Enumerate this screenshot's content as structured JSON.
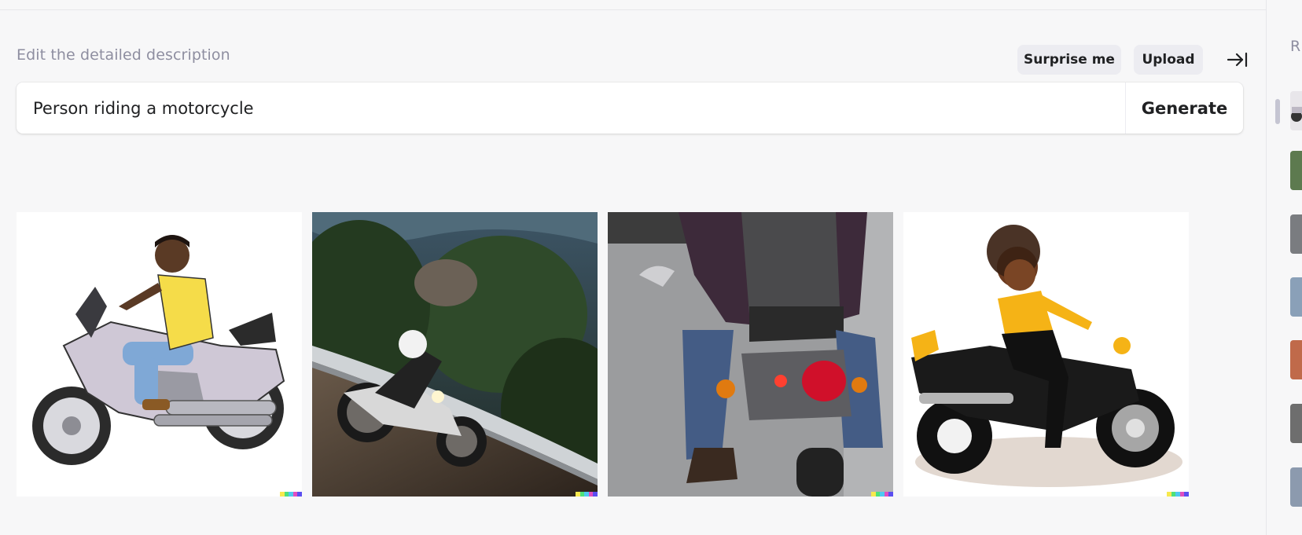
{
  "header": {
    "hint": "Edit the detailed description",
    "surprise_label": "Surprise me",
    "upload_label": "Upload"
  },
  "prompt": {
    "value": "Person riding a motorcycle",
    "generate_label": "Generate"
  },
  "results": [
    {
      "style": "illustration",
      "description": "man in yellow shirt on silver motorcycle"
    },
    {
      "style": "photo",
      "description": "rider leaning into curve on mountain road"
    },
    {
      "style": "photo",
      "description": "rear view of rider in leather vest"
    },
    {
      "style": "illustration",
      "description": "woman on black motorcycle"
    }
  ],
  "right_panel": {
    "title_initial": "R"
  },
  "colors": {
    "background": "#f7f7f8",
    "pill": "#ececf1",
    "text": "#202123",
    "muted": "#8e8ea0",
    "badge": [
      "#f7e94e",
      "#4ee07a",
      "#4ec8f0",
      "#e04ec0",
      "#5b4ef0"
    ]
  },
  "icons": {
    "collapse": "arrow-right-to-bar-icon"
  }
}
